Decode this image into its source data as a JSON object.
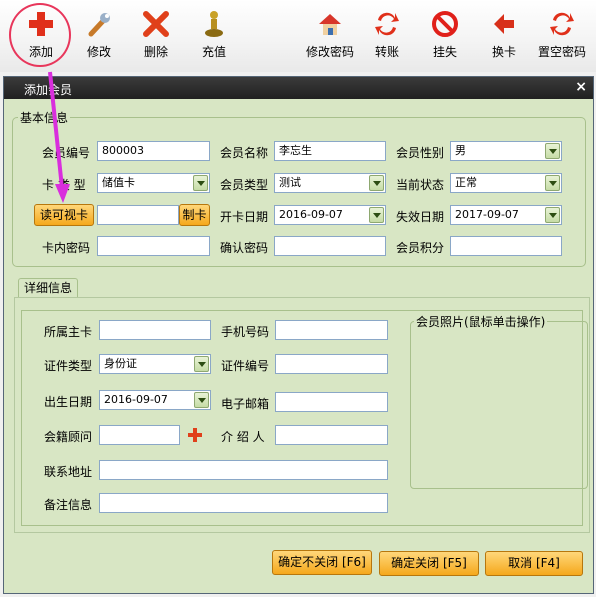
{
  "toolbar": {
    "items": [
      {
        "label": "添加",
        "icon": "plus-icon"
      },
      {
        "label": "修改",
        "icon": "wrench-icon"
      },
      {
        "label": "删除",
        "icon": "delete-x-icon"
      },
      {
        "label": "充值",
        "icon": "recharge-pawn-icon"
      },
      {
        "label": "修改密码",
        "icon": "house-icon"
      },
      {
        "label": "转账",
        "icon": "transfer-icon"
      },
      {
        "label": "挂失",
        "icon": "report-loss-icon"
      },
      {
        "label": "换卡",
        "icon": "swap-card-icon"
      },
      {
        "label": "置空密码",
        "icon": "clear-password-icon"
      }
    ]
  },
  "window": {
    "title": "添加会员",
    "close": "×"
  },
  "basic": {
    "group_title": "基本信息",
    "member_no_label": "会员编号",
    "member_no": "800003",
    "member_name_label": "会员名称",
    "member_name": "李忘生",
    "gender_label": "会员性别",
    "gender": "男",
    "card_type_label": "卡 类 型",
    "card_type": "储值卡",
    "member_type_label": "会员类型",
    "member_type": "测试",
    "status_label": "当前状态",
    "status": "正常",
    "read_card_button": "读可视卡",
    "card_no": "",
    "make_card_button": "制卡",
    "open_date_label": "开卡日期",
    "open_date": "2016-09-07",
    "expire_date_label": "失效日期",
    "expire_date": "2017-09-07",
    "card_password_label": "卡内密码",
    "confirm_password_label": "确认密码",
    "points_label": "会员积分"
  },
  "details": {
    "tab_label": "详细信息",
    "main_card_label": "所属主卡",
    "phone_label": "手机号码",
    "id_type_label": "证件类型",
    "id_type": "身份证",
    "id_no_label": "证件编号",
    "birth_label": "出生日期",
    "birth_date": "2016-09-07",
    "email_label": "电子邮箱",
    "advisor_label": "会籍顾问",
    "referrer_label": "介 绍 人",
    "address_label": "联系地址",
    "remark_label": "备注信息",
    "photo_label": "会员照片(鼠标单击操作)"
  },
  "footer": {
    "confirm_keep_open": "确定不关闭 [F6]",
    "confirm_close": "确定关闭 [F5]",
    "cancel": "取消 [F4]"
  },
  "colors": {
    "panel_bg": "#d8e6c4",
    "title_bar": "#2a2a2a",
    "orange_button": "#f5a81c",
    "annotation": "#e8365b",
    "arrow": "#d92edd"
  }
}
